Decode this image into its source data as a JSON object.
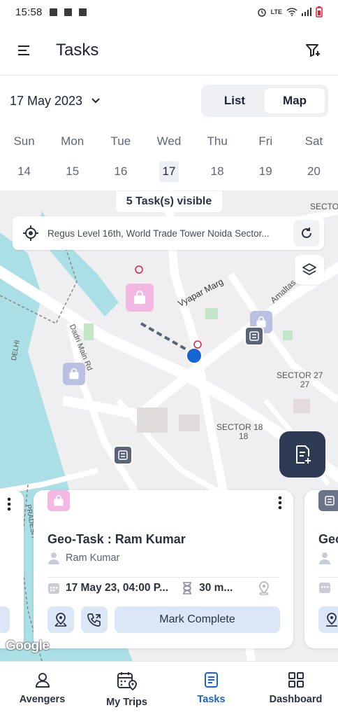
{
  "status": {
    "time": "15:58",
    "network": "LTE"
  },
  "header": {
    "title": "Tasks",
    "menu_icon": "hamburger-icon",
    "filter_icon": "filter-icon"
  },
  "date": {
    "label": "17 May 2023"
  },
  "view_toggle": {
    "list_label": "List",
    "map_label": "Map",
    "selected": "Map"
  },
  "week": [
    {
      "name": "Sun",
      "date": "14"
    },
    {
      "name": "Mon",
      "date": "15"
    },
    {
      "name": "Tue",
      "date": "16"
    },
    {
      "name": "Wed",
      "date": "17"
    },
    {
      "name": "Thu",
      "date": "18"
    },
    {
      "name": "Fri",
      "date": "19"
    },
    {
      "name": "Sat",
      "date": "20"
    }
  ],
  "map": {
    "visible_count_text": "5 Task(s) visible",
    "address": "Regus Level 16th, World Trade Tower Noida Sector...",
    "labels": {
      "vyapar": "Vyapar Marg",
      "amaltas": "Amaltas",
      "dadri": "Dadri Main Rd",
      "sector27": "SECTOR 27",
      "sector27b": "27",
      "sector18": "SECTOR 18",
      "sector18b": "18",
      "sector_top": "SECTO",
      "delhi": "DELHI",
      "pradesh": "PRADESH"
    },
    "attribution": "Google"
  },
  "cards": {
    "main": {
      "title": "Geo-Task : Ram Kumar",
      "user": "Ram Kumar",
      "datetime": "17 May 23, 04:00 P...",
      "duration": "30 m...",
      "mark_complete": "Mark Complete"
    },
    "right": {
      "title": "Geo"
    }
  },
  "nav": [
    {
      "label": "Avengers",
      "icon": "person-icon"
    },
    {
      "label": "My Trips",
      "icon": "calendar-map-icon"
    },
    {
      "label": "Tasks",
      "icon": "document-icon",
      "active": true
    },
    {
      "label": "Dashboard",
      "icon": "grid-icon"
    }
  ],
  "colors": {
    "accent": "#1763d4",
    "fab": "#2f3b55",
    "water": "#aadfe6",
    "pink_pin": "#f3b8e2",
    "button_bg": "#dbe7f7"
  }
}
